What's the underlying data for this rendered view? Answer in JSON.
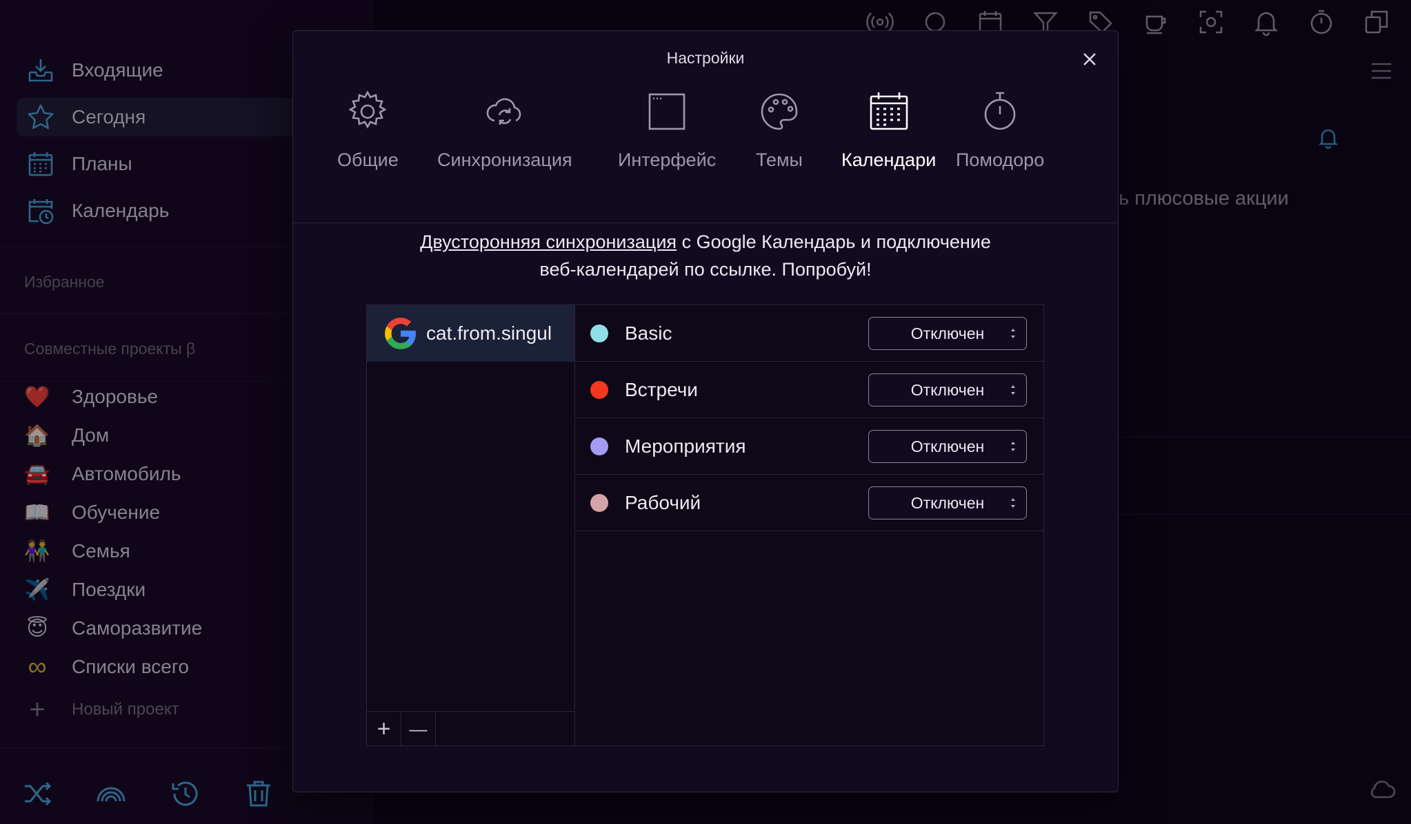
{
  "sidebar": {
    "nav": [
      {
        "label": "Входящие",
        "icon": "inbox-icon"
      },
      {
        "label": "Сегодня",
        "icon": "star-icon"
      },
      {
        "label": "Планы",
        "icon": "calendar-grid-icon"
      },
      {
        "label": "Календарь",
        "icon": "calendar-clock-icon"
      }
    ],
    "favorites_title": "Избранное",
    "shared_title": "Совместные проекты β",
    "projects": [
      {
        "label": "Здоровье",
        "emoji": "❤️"
      },
      {
        "label": "Дом",
        "emoji": "🏠"
      },
      {
        "label": "Автомобиль",
        "emoji": "🚘"
      },
      {
        "label": "Обучение",
        "emoji": "📖"
      },
      {
        "label": "Семья",
        "emoji": "👫"
      },
      {
        "label": "Поездки",
        "emoji": "✈️"
      },
      {
        "label": "Саморазвитие",
        "emoji": "😇"
      },
      {
        "label": "Списки всего",
        "emoji": "∞"
      }
    ],
    "new_project": "Новый проект",
    "bottom_icons": [
      "shuffle-icon",
      "wifi-icon",
      "history-icon",
      "trash-icon"
    ]
  },
  "main": {
    "promo_partial": "ь плюсовые акции",
    "top_icons": [
      "broadcast-icon",
      "circle-icon",
      "calendar-icon",
      "filter-icon",
      "tag-icon",
      "coffee-icon",
      "focus-icon",
      "bell-icon",
      "timer-icon",
      "copy-icon"
    ]
  },
  "modal": {
    "title": "Настройки",
    "tabs": [
      {
        "label": "Общие",
        "icon": "gear-icon"
      },
      {
        "label": "Синхронизация",
        "icon": "cloud-sync-icon"
      },
      {
        "label": "Интерфейс",
        "icon": "window-icon"
      },
      {
        "label": "Темы",
        "icon": "palette-icon"
      },
      {
        "label": "Календари",
        "icon": "calendar-icon",
        "active": true
      },
      {
        "label": "Помодоро",
        "icon": "stopwatch-icon"
      }
    ],
    "promo_link": "Двусторонняя синхронизация",
    "promo_rest1": " с Google Календарь и подключение",
    "promo_rest2": "веб-календарей по ссылке. Попробуй!",
    "account": "cat.from.singul",
    "calendars": [
      {
        "name": "Basic",
        "color": "#8fe0e6",
        "status": "Отключен"
      },
      {
        "name": "Встречи",
        "color": "#f4371f",
        "status": "Отключен"
      },
      {
        "name": "Мероприятия",
        "color": "#a49bf2",
        "status": "Отключен"
      },
      {
        "name": "Рабочий",
        "color": "#d3a5a8",
        "status": "Отключен"
      }
    ],
    "add_label": "+",
    "remove_label": "—"
  }
}
